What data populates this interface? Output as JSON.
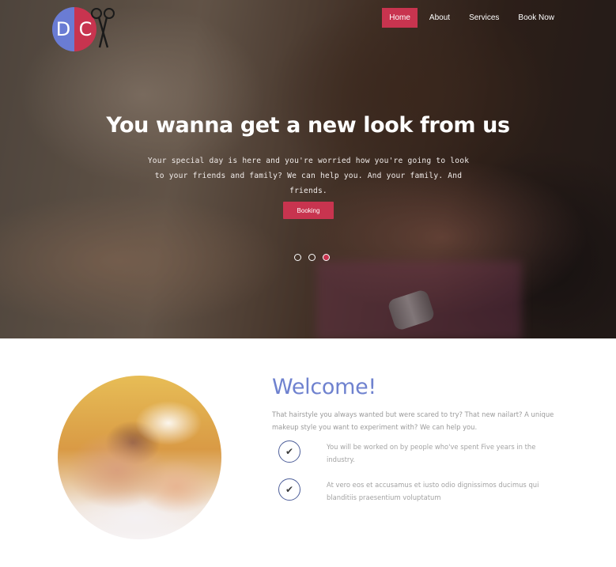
{
  "brand": {
    "logo_left": "D",
    "logo_right": "C",
    "left_color": "#6a7cd4",
    "right_color": "#c8344f"
  },
  "nav": {
    "items": [
      {
        "label": "Home",
        "active": true
      },
      {
        "label": "About"
      },
      {
        "label": "Services"
      },
      {
        "label": "Book Now"
      }
    ]
  },
  "hero": {
    "title": "You wanna get a new look from us",
    "subtitle": "Your special day is here and you're worried how you're going to look to your friends and family? We can help you. And your family. And friends.",
    "button": "Booking",
    "slides_total": 3,
    "active_slide": 3
  },
  "welcome": {
    "title": "Welcome!",
    "intro": "That hairstyle you always wanted but were scared to try? That new nailart? A unique makeup style you want to experiment with? We can help you.",
    "features": [
      {
        "icon": "check-icon",
        "text": "You will be worked on by people who've spent Five years in the industry."
      },
      {
        "icon": "check-icon",
        "text": "At vero eos et accusamus et iusto odio dignissimos ducimus qui blanditiis praesentium voluptatum"
      }
    ]
  },
  "colors": {
    "accent": "#c8344f",
    "welcome_title": "#6f82cf"
  }
}
